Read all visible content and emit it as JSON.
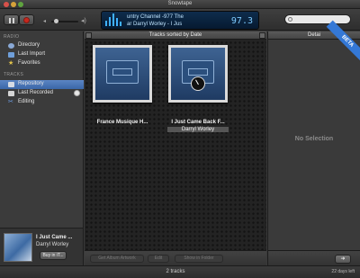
{
  "window": {
    "title": "Snowtape"
  },
  "toolbar": {
    "lcd": {
      "line1": "untry Channel  -977 The",
      "line2": "ar   Darryl Worley - I Jus",
      "frequency": "97.3"
    }
  },
  "sidebar": {
    "radio_header": "RADIO",
    "tracks_header": "TRACKS",
    "radio_items": [
      {
        "label": "Directory",
        "icon": "globe-icon"
      },
      {
        "label": "Last Import",
        "icon": "import-icon"
      },
      {
        "label": "Favorites",
        "icon": "star-icon"
      }
    ],
    "track_items": [
      {
        "label": "Repository",
        "icon": "repository-icon",
        "selected": true
      },
      {
        "label": "Last Recorded",
        "icon": "recorded-icon"
      },
      {
        "label": "Editing",
        "icon": "scissors-icon"
      }
    ]
  },
  "now_playing": {
    "title": "I Just Came ...",
    "artist": "Darryl Worley",
    "button_label": "Buy in iT..."
  },
  "center": {
    "header": "Tracks sorted by Date",
    "tiles": [
      {
        "title": "France Musique H...",
        "subtitle": ""
      },
      {
        "title": "I Just Came Back F...",
        "subtitle": "Darryl Worley"
      }
    ],
    "footer_buttons": [
      "Get Album Artwork",
      "Edit",
      "Show in Folder"
    ]
  },
  "right": {
    "header": "Detai",
    "badge": "BETA",
    "empty_text": "No Selection"
  },
  "status": {
    "center": "2 tracks",
    "right": "22 days left"
  },
  "colors": {
    "accent": "#3478d6",
    "selection": "#4a76b8",
    "record": "#c8281e",
    "lcd_bg": "#0e2c4c"
  }
}
